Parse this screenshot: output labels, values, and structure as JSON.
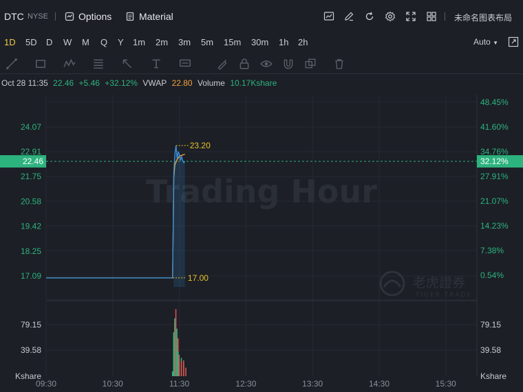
{
  "header": {
    "ticker": "DTC",
    "exchange": "NYSE",
    "options_label": "Options",
    "material_label": "Material",
    "layout_label": "未命名图表布局"
  },
  "timeframes": {
    "items": [
      "1D",
      "5D",
      "D",
      "W",
      "M",
      "Q",
      "Y",
      "1m",
      "2m",
      "3m",
      "5m",
      "15m",
      "30m",
      "1h",
      "2h"
    ],
    "active": "1D",
    "scale_mode": "Auto"
  },
  "info": {
    "datetime": "Oct 28 11:35",
    "price": "22.46",
    "change": "+5.46",
    "change_pct": "+32.12%",
    "vwap_label": "VWAP",
    "vwap_value": "22.80",
    "volume_label": "Volume",
    "volume_value": "10.17Kshare"
  },
  "chart_data": {
    "type": "line",
    "watermark": "Trading Hour",
    "brand_cn": "老虎證券",
    "brand_en": "TIGER TRADE",
    "x_ticks": [
      "09:30",
      "10:30",
      "11:30",
      "12:30",
      "13:30",
      "14:30",
      "15:30"
    ],
    "left_y_ticks": [
      "24.07",
      "22.91",
      "21.75",
      "20.58",
      "19.42",
      "18.25",
      "17.09"
    ],
    "right_y_ticks": [
      "48.45%",
      "41.60%",
      "34.76%",
      "27.91%",
      "21.07%",
      "14.23%",
      "7.38%",
      "0.54%"
    ],
    "current_price": "22.46",
    "current_pct": "32.12%",
    "high_marker": "23.20",
    "low_marker": "17.00",
    "price_series": {
      "name": "Price",
      "points": [
        [
          "09:30",
          17.0
        ],
        [
          "11:24",
          17.0
        ],
        [
          "11:25",
          21.9
        ],
        [
          "11:26",
          22.8
        ],
        [
          "11:27",
          23.2
        ],
        [
          "11:28",
          22.6
        ],
        [
          "11:29",
          22.9
        ],
        [
          "11:30",
          22.8
        ],
        [
          "11:31",
          22.5
        ],
        [
          "11:32",
          22.7
        ],
        [
          "11:33",
          22.5
        ],
        [
          "11:34",
          22.4
        ],
        [
          "11:35",
          22.46
        ]
      ]
    },
    "vwap_series": {
      "name": "VWAP",
      "points": [
        [
          "09:30",
          17.0
        ],
        [
          "11:24",
          17.0
        ],
        [
          "11:25",
          21.7
        ],
        [
          "11:26",
          22.3
        ],
        [
          "11:28",
          22.55
        ],
        [
          "11:30",
          22.7
        ],
        [
          "11:35",
          22.8
        ]
      ]
    },
    "volume_axis_ticks": [
      "79.15",
      "39.58"
    ],
    "volume_unit": "Kshare",
    "volume_bars": [
      {
        "t": "11:24",
        "v": 8,
        "dir": "up"
      },
      {
        "t": "11:24",
        "v": 20,
        "dir": "up"
      },
      {
        "t": "11:25",
        "v": 72,
        "dir": "up"
      },
      {
        "t": "11:25",
        "v": 88,
        "dir": "down"
      },
      {
        "t": "11:26",
        "v": 95,
        "dir": "up"
      },
      {
        "t": "11:26",
        "v": 65,
        "dir": "down"
      },
      {
        "t": "11:27",
        "v": 110,
        "dir": "down"
      },
      {
        "t": "11:27",
        "v": 78,
        "dir": "up"
      },
      {
        "t": "11:28",
        "v": 50,
        "dir": "up"
      },
      {
        "t": "11:28",
        "v": 62,
        "dir": "down"
      },
      {
        "t": "11:29",
        "v": 40,
        "dir": "up"
      },
      {
        "t": "11:29",
        "v": 35,
        "dir": "down"
      },
      {
        "t": "11:30",
        "v": 28,
        "dir": "down"
      },
      {
        "t": "11:31",
        "v": 30,
        "dir": "up"
      },
      {
        "t": "11:32",
        "v": 24,
        "dir": "down"
      },
      {
        "t": "11:33",
        "v": 20,
        "dir": "up"
      },
      {
        "t": "11:34",
        "v": 26,
        "dir": "down"
      },
      {
        "t": "11:35",
        "v": 14,
        "dir": "down"
      }
    ],
    "colors": {
      "up": "#2db37e",
      "down": "#e0504f",
      "price_line": "#3a8fd8",
      "vwap_line": "#f2a33a",
      "accent_green": "#2db37e",
      "marker_yellow": "#e6c229"
    }
  }
}
